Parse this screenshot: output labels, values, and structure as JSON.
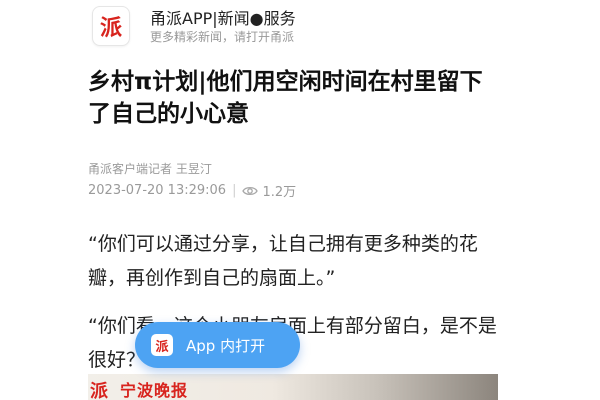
{
  "header": {
    "logo_text": "派",
    "app_title": "甬派APP|新闻●服务",
    "subtitle": "更多精彩新闻，请打开甬派"
  },
  "article": {
    "title": "乡村π计划|他们用空闲时间在村里留下了自己的小心意",
    "byline": "甬派客户端记者 王昱汀",
    "datetime": "2023-07-20 13:29:06",
    "separator": "|",
    "views": "1.2万",
    "paragraph1": "“你们可以通过分享，让自己拥有更多种类的花瓣，再创作到自己的扇面上。”",
    "paragraph2": "“你们看，这个小朋友扇面上有部分留白，是不是很好？”"
  },
  "float_button": {
    "label": "App 内打开",
    "icon": "app-logo-icon",
    "accent": "#4da3f3"
  },
  "banner": {
    "logo_text": "派",
    "text": "宁波晚报"
  },
  "colors": {
    "brand_red": "#d8241e",
    "muted_text": "#9a9a9a"
  }
}
